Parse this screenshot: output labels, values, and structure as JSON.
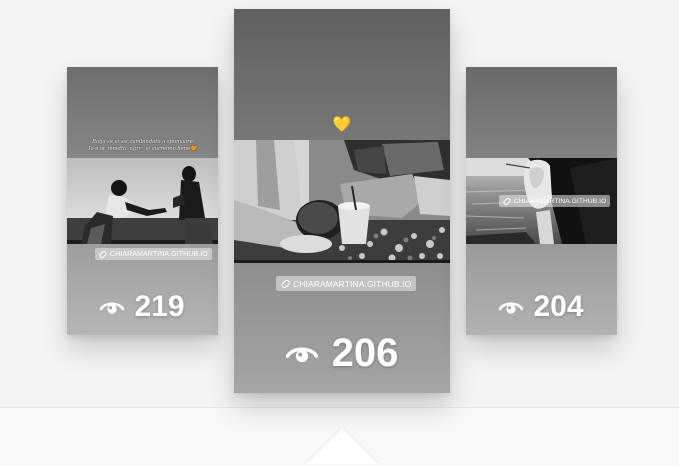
{
  "stories": [
    {
      "caption_line1": "Baija se vi ssi cumbindato a spumaare",
      "caption_line2": "Io e at_mmdhz_ngrr_ vi curreimo bene",
      "caption_heart": "🧡",
      "link_label": "CHIARAMARTINA.GITHUB.IO",
      "views": "219",
      "eye_icon": "eye-icon"
    },
    {
      "heart": "💛",
      "link_label": "CHIARAMARTINA.GITHUB.IO",
      "views": "206",
      "eye_icon": "eye-icon"
    },
    {
      "link_label": "CHIARAMARTINA.GITHUB.IO",
      "views": "204",
      "eye_icon": "eye-icon"
    }
  ],
  "colors": {
    "page_bg": "#f4f4f4",
    "card_gradient_top": "#606060",
    "card_gradient_bottom": "#a5a5a5",
    "heart": "#ffd21e",
    "text": "#ffffff"
  }
}
